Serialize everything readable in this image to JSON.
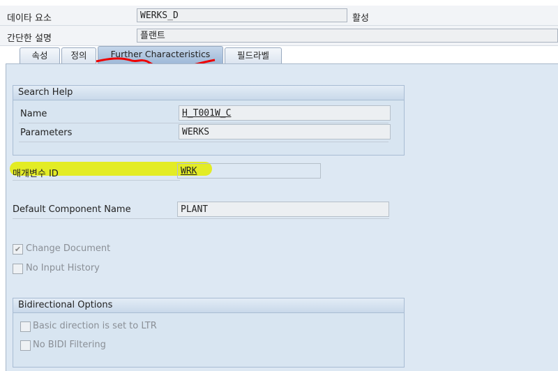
{
  "header": {
    "data_element_label": "데이타 요소",
    "data_element_value": "WERKS_D",
    "status": "활성",
    "short_desc_label": "간단한 설명",
    "short_desc_value": "플랜트"
  },
  "tabs": [
    {
      "label": "속성"
    },
    {
      "label": "정의"
    },
    {
      "label": "Further Characteristics",
      "active": true
    },
    {
      "label": "필드라벨"
    }
  ],
  "search_help": {
    "title": "Search Help",
    "name_label": "Name",
    "name_value": "H_T001W_C",
    "params_label": "Parameters",
    "params_value": "WERKS"
  },
  "parameter_id": {
    "label": "매개변수 ID",
    "value": "WRK"
  },
  "default_component": {
    "label": "Default Component Name",
    "value": "PLANT"
  },
  "checkboxes": [
    {
      "label": "Change Document",
      "checked": true
    },
    {
      "label": "No Input History",
      "checked": false
    }
  ],
  "bidi": {
    "title": "Bidirectional Options",
    "options": [
      {
        "label": "Basic direction is set to LTR",
        "checked": false
      },
      {
        "label": "No BIDI Filtering",
        "checked": false
      }
    ]
  }
}
